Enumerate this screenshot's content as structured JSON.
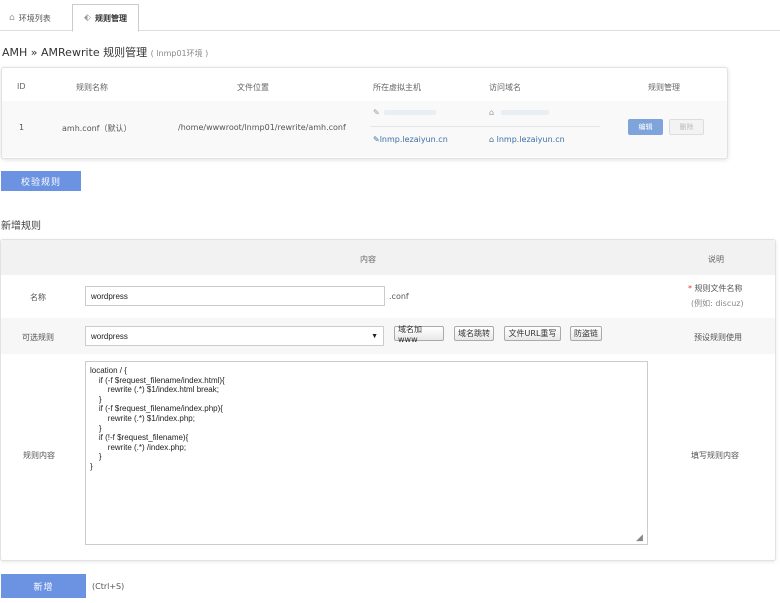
{
  "tabs": [
    {
      "label": "环境列表",
      "icon": "home-icon"
    },
    {
      "label": "规则管理",
      "icon": "tag-icon"
    }
  ],
  "breadcrumb": {
    "text": "AMH » AMRewrite 规则管理",
    "env": "( lnmp01环境 )"
  },
  "rules_table": {
    "headers": [
      "ID",
      "规则名称",
      "文件位置",
      "所在虚拟主机",
      "访问域名",
      "规则管理"
    ],
    "row": {
      "id": "1",
      "name": "amh.conf（默认）",
      "path": "/home/wwwroot/lnmp01/rewrite/amh.conf",
      "host": "lnmp.lezaiyun.cn",
      "domain": "lnmp.lezaiyun.cn",
      "edit": "编辑",
      "delete": "删除"
    }
  },
  "check_button": "校验规则",
  "new_rule": {
    "title": "新增规则",
    "header_content": "内容",
    "header_desc": "说明",
    "name_label": "名称",
    "name_value": "wordpress",
    "suffix": ".conf",
    "name_hint_star": "*",
    "name_hint": "规则文件名称",
    "name_hint_example": "(例如: discuz)",
    "optional_label": "可选规则",
    "select_value": "wordpress",
    "buttons": [
      "域名加www",
      "域名跳转",
      "文件URL重写",
      "防盗链"
    ],
    "preset_hint": "预设规则使用",
    "content_label": "规则内容",
    "content_value": "location / {\n    if (-f $request_filename/index.html){\n        rewrite (.*) $1/index.html break;\n    }\n    if (-f $request_filename/index.php){\n        rewrite (.*) $1/index.php;\n    }\n    if (!-f $request_filename){\n        rewrite (.*) /index.php;\n    }\n}",
    "content_hint": "填写规则内容",
    "submit": "新增",
    "shortcut": "(Ctrl+S)"
  },
  "colors": {
    "accent": "#6b93e2",
    "link": "#3b6fa6",
    "star": "#e03c3c"
  }
}
